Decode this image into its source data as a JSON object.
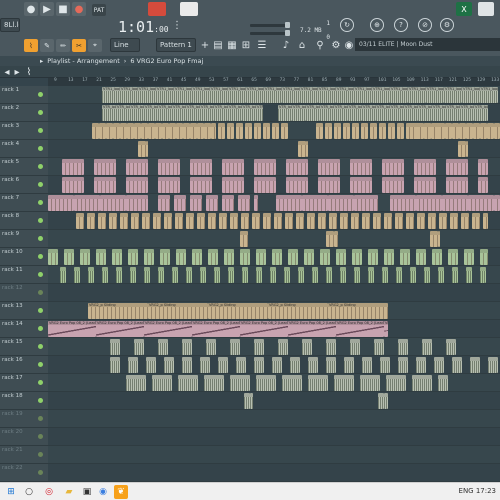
{
  "toolbar": {
    "left_box": "8Ll.loo",
    "clock_main": "1:01",
    "clock_frac": ":00",
    "tempo_value": "1",
    "tempo_label": "7.2 MB",
    "tempo_sub": "0",
    "mode_select": "Line",
    "pattern_select": "Pattern 1",
    "song_title": "03/11  ELITE | Moon Dust"
  },
  "playlist": {
    "arrow": "▸",
    "title": "Playlist - Arrangement",
    "separator": "›",
    "subtitle": "6 VRG2 Euro Pop Fmaj",
    "ruler_ticks": [
      "9",
      "13",
      "17",
      "21",
      "25",
      "29",
      "33",
      "37",
      "41",
      "45",
      "49",
      "53",
      "57",
      "61",
      "65",
      "69",
      "73",
      "77",
      "81",
      "85",
      "89",
      "93",
      "97",
      "101",
      "105",
      "109",
      "113",
      "117",
      "121",
      "125",
      "129",
      "133",
      "137",
      "141",
      "145",
      "149",
      "153",
      "157",
      "161",
      "165",
      "169",
      "173",
      "177",
      "181",
      "185",
      "189",
      "193",
      "197",
      "201",
      "205",
      "209",
      "213",
      "217",
      "221",
      "225",
      "229",
      "233",
      "237",
      "241",
      "245",
      "249",
      "253"
    ],
    "tracks": [
      {
        "name": "rack 1",
        "dim": false
      },
      {
        "name": "rack 2",
        "dim": false
      },
      {
        "name": "rack 3",
        "dim": false
      },
      {
        "name": "rack 4",
        "dim": false
      },
      {
        "name": "rack 5",
        "dim": false
      },
      {
        "name": "rack 6",
        "dim": false
      },
      {
        "name": "rack 7",
        "dim": false
      },
      {
        "name": "rack 8",
        "dim": false
      },
      {
        "name": "rack 9",
        "dim": false
      },
      {
        "name": "rack 10",
        "dim": false
      },
      {
        "name": "rack 11",
        "dim": false
      },
      {
        "name": "rack 12",
        "dim": true
      },
      {
        "name": "rack 13",
        "dim": false
      },
      {
        "name": "rack 14",
        "dim": false
      },
      {
        "name": "rack 15",
        "dim": false
      },
      {
        "name": "rack 16",
        "dim": false
      },
      {
        "name": "rack 17",
        "dim": false
      },
      {
        "name": "rack 18",
        "dim": false
      },
      {
        "name": "rack 19",
        "dim": true
      },
      {
        "name": "rack 20",
        "dim": true
      },
      {
        "name": "rack 21",
        "dim": true
      },
      {
        "name": "rack 22",
        "dim": true
      }
    ]
  },
  "clip_labels": {
    "track1": "VTR1_loop",
    "track2": "VTR_loop",
    "track13": "VRG2_p Sliding",
    "track14": "VRG2 Euro Pop 08_2 (Leading) Tricky"
  },
  "colors": {
    "toolbar_bg": "#4a575e",
    "lane_bg": "#37474d",
    "clip_tan": "#c9b48f",
    "clip_pink": "#c8a3b0",
    "clip_green": "#a9c49a",
    "clip_grey": "#b8c0b2",
    "accent_orange": "#f0a030"
  },
  "taskbar": {
    "clock": "ENG  17:23",
    "icons": [
      "windows-icon",
      "search-icon",
      "opera-icon",
      "explorer-icon",
      "store-icon",
      "chrome-icon",
      "fl-studio-icon"
    ]
  }
}
